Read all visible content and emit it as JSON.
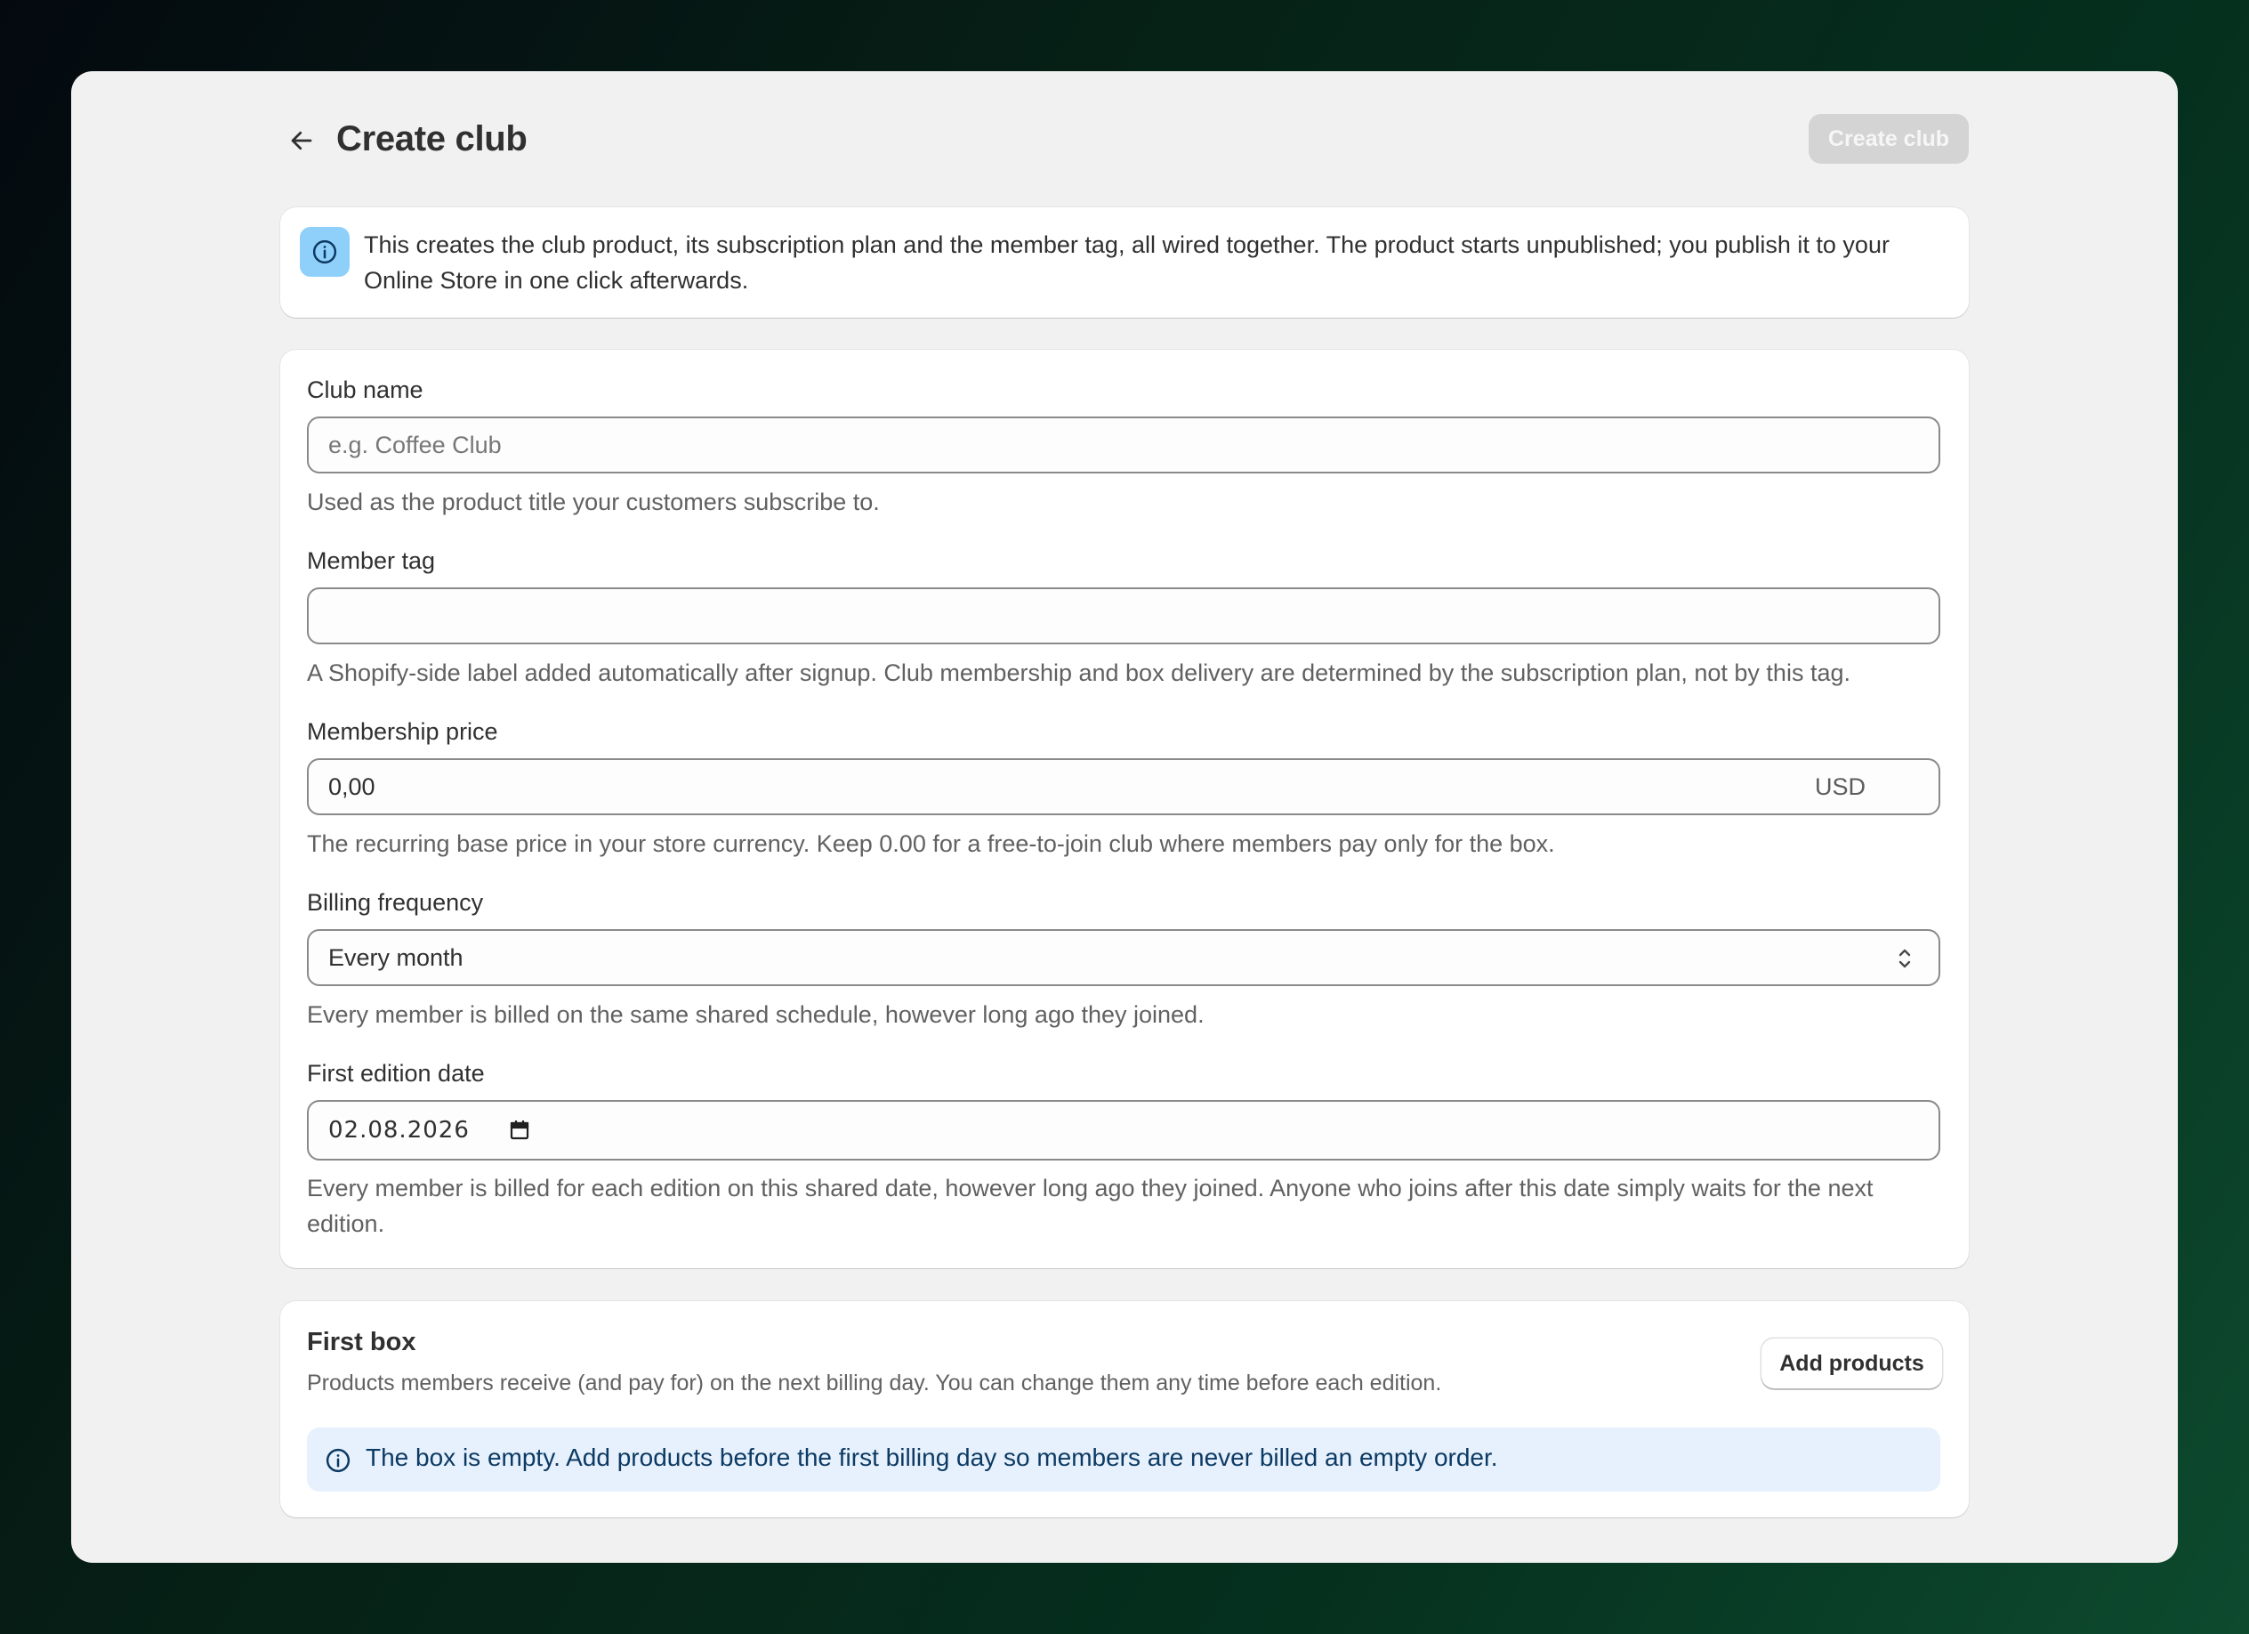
{
  "header": {
    "title": "Create club",
    "create_label": "Create club"
  },
  "info": {
    "text": "This creates the club product, its subscription plan and the member tag, all wired together. The product starts unpublished; you publish it to your Online Store in one click afterwards."
  },
  "form": {
    "club_name": {
      "label": "Club name",
      "value": "",
      "placeholder": "e.g. Coffee Club",
      "help": "Used as the product title your customers subscribe to."
    },
    "member_tag": {
      "label": "Member tag",
      "value": "",
      "help": "A Shopify-side label added automatically after signup. Club membership and box delivery are determined by the subscription plan, not by this tag."
    },
    "membership_price": {
      "label": "Membership price",
      "value": "0,00",
      "suffix": "USD",
      "help": "The recurring base price in your store currency. Keep 0.00 for a free-to-join club where members pay only for the box."
    },
    "billing_frequency": {
      "label": "Billing frequency",
      "selected": "Every month",
      "help": "Every member is billed on the same shared schedule, however long ago they joined."
    },
    "first_edition_date": {
      "label": "First edition date",
      "value": "02.08.2026",
      "help": "Every member is billed for each edition on this shared date, however long ago they joined. Anyone who joins after this date simply waits for the next edition."
    }
  },
  "first_box": {
    "title": "First box",
    "subtitle": "Products members receive (and pay for) on the next billing day. You can change them any time before each edition.",
    "add_products_label": "Add products",
    "banner_text": "The box is empty. Add products before the first billing day so members are never billed an empty order."
  },
  "icons": {
    "back": "arrow-left-icon",
    "info": "info-icon",
    "select": "chevron-up-down-icon",
    "calendar": "calendar-icon"
  },
  "colors": {
    "info_icon_bg": "#8fd0fb",
    "banner_bg": "#e6f1fd",
    "banner_text": "#0d3a63",
    "disabled_button": "#d4d4d4"
  }
}
